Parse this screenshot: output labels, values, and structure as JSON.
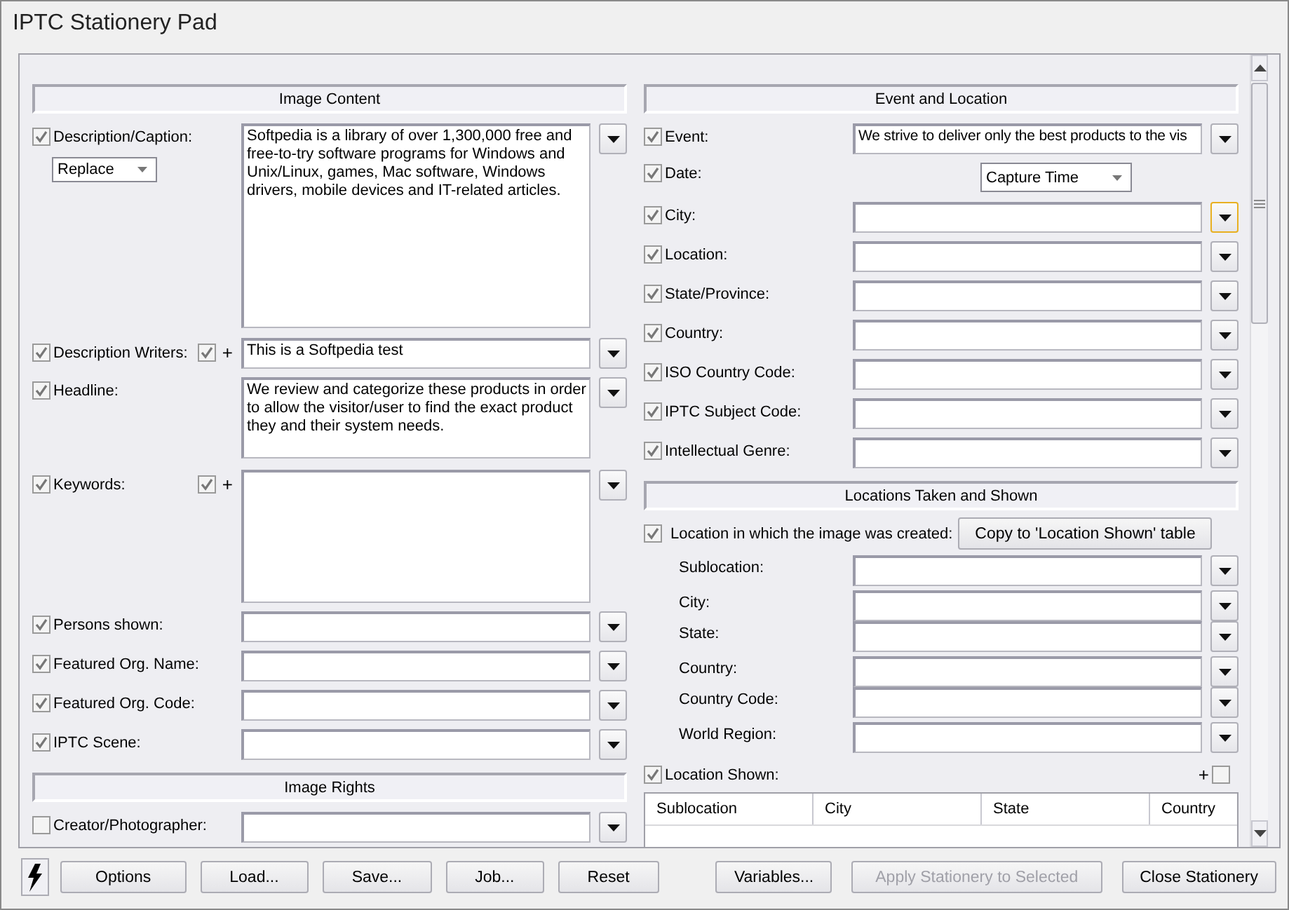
{
  "window": {
    "title": "IPTC Stationery Pad"
  },
  "image_content": {
    "heading": "Image Content",
    "fields": [
      {
        "kind": "large_area",
        "label": "Description/Caption:",
        "checked": true,
        "mode": "Replace",
        "value": "Softpedia is a library of over 1,300,000 free and free-to-try software programs for Windows and Unix/Linux, games, Mac software, Windows drivers, mobile devices and IT-related articles."
      },
      {
        "kind": "line",
        "label": "Description Writers:",
        "checked": true,
        "append": {
          "checked": true,
          "symbol": "+"
        },
        "value": "This is a Softpedia test"
      },
      {
        "kind": "medium_area",
        "label": "Headline:",
        "checked": true,
        "value": "We review and categorize these products in order to allow the visitor/user to find the exact product they and their system needs."
      },
      {
        "kind": "list_area",
        "label": "Keywords:",
        "checked": true,
        "append": {
          "checked": true,
          "symbol": "+"
        }
      },
      {
        "kind": "line",
        "label": "Persons shown:",
        "checked": true
      },
      {
        "kind": "line",
        "label": "Featured Org. Name:",
        "checked": true
      },
      {
        "kind": "line",
        "label": "Featured Org. Code:",
        "checked": true
      },
      {
        "kind": "line",
        "label": "IPTC Scene:",
        "checked": true
      }
    ]
  },
  "image_rights": {
    "heading": "Image Rights",
    "fields": [
      {
        "kind": "line",
        "label": "Creator/Photographer:",
        "checked": false
      }
    ]
  },
  "event_location": {
    "heading": "Event and Location",
    "fields": [
      {
        "kind": "line",
        "label": "Event:",
        "checked": true,
        "focused": false,
        "value": "We strive to deliver only the best products to the vis"
      },
      {
        "kind": "select",
        "label": "Date:",
        "checked": true,
        "value": "Capture Time"
      },
      {
        "kind": "line",
        "label": "City:",
        "checked": true,
        "focused": true
      },
      {
        "kind": "line",
        "label": "Location:",
        "checked": true,
        "focused": false
      },
      {
        "kind": "line",
        "label": "State/Province:",
        "checked": true,
        "focused": false
      },
      {
        "kind": "line",
        "label": "Country:",
        "checked": true,
        "focused": false
      },
      {
        "kind": "line",
        "label": "ISO Country Code:",
        "checked": true,
        "focused": false
      },
      {
        "kind": "line",
        "label": "IPTC Subject Code:",
        "checked": true,
        "focused": false
      },
      {
        "kind": "line",
        "label": "Intellectual Genre:",
        "checked": true,
        "focused": false
      }
    ]
  },
  "locations": {
    "heading": "Locations Taken and Shown",
    "created": {
      "label": "Location in which the image was created:",
      "checked": true,
      "button": "Copy to 'Location Shown' table"
    },
    "fields": [
      {
        "label": "Sublocation:"
      },
      {
        "label": "City:"
      },
      {
        "label": "State:"
      },
      {
        "label": "Country:"
      },
      {
        "label": "Country Code:"
      },
      {
        "label": "World Region:"
      }
    ],
    "shown": {
      "label": "Location Shown:",
      "checked": true,
      "add": {
        "symbol": "+",
        "checked": false
      }
    },
    "table": {
      "columns": [
        "Sublocation",
        "City",
        "State",
        "Country"
      ]
    }
  },
  "buttons_left": [
    {
      "label": "Options",
      "disabled": false
    },
    {
      "label": "Load...",
      "disabled": false
    },
    {
      "label": "Save...",
      "disabled": false
    },
    {
      "label": "Job...",
      "disabled": false
    },
    {
      "label": "Reset",
      "disabled": false
    }
  ],
  "buttons_right": [
    {
      "label": "Variables...",
      "disabled": false
    },
    {
      "label": "Apply Stationery to Selected",
      "disabled": true
    },
    {
      "label": "Close Stationery",
      "disabled": false
    }
  ]
}
